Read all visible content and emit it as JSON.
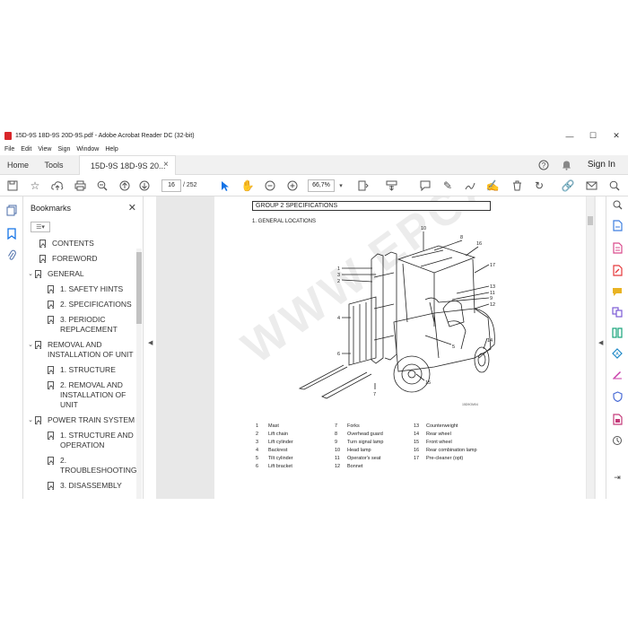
{
  "window": {
    "title": "15D-9S 18D-9S 20D-9S.pdf - Adobe Acrobat Reader DC (32-bit)",
    "minimize": "—",
    "maximize": "☐",
    "close": "✕"
  },
  "menu": [
    "File",
    "Edit",
    "View",
    "Sign",
    "Window",
    "Help"
  ],
  "tabs": {
    "home": "Home",
    "tools": "Tools",
    "document": "15D-9S 18D-9S 20...",
    "close": "×",
    "sign_in": "Sign In"
  },
  "toolbar": {
    "page_current": "16",
    "page_total": "/ 252",
    "zoom": "66,7%"
  },
  "bookmarks": {
    "header": "Bookmarks",
    "close": "✕",
    "options": "☰▾",
    "items": [
      {
        "label": "CONTENTS",
        "level": 0,
        "chevron": ""
      },
      {
        "label": "FOREWORD",
        "level": 0,
        "chevron": ""
      },
      {
        "label": "GENERAL",
        "level": 0,
        "chevron": "⌄"
      },
      {
        "label": "1. SAFETY HINTS",
        "level": 1,
        "chevron": ""
      },
      {
        "label": "2. SPECIFICATIONS",
        "level": 1,
        "chevron": ""
      },
      {
        "label": "3. PERIODIC REPLACEMENT",
        "level": 1,
        "chevron": ""
      },
      {
        "label": "REMOVAL AND INSTALLATION OF UNIT",
        "level": 0,
        "chevron": "⌄"
      },
      {
        "label": "1. STRUCTURE",
        "level": 1,
        "chevron": ""
      },
      {
        "label": "2. REMOVAL AND INSTALLATION OF UNIT",
        "level": 1,
        "chevron": ""
      },
      {
        "label": "POWER TRAIN SYSTEM",
        "level": 0,
        "chevron": "⌄"
      },
      {
        "label": "1. STRUCTURE AND OPERATION",
        "level": 1,
        "chevron": ""
      },
      {
        "label": "2. TROUBLESHOOTING",
        "level": 1,
        "chevron": ""
      },
      {
        "label": "3. DISASSEMBLY",
        "level": 1,
        "chevron": ""
      }
    ]
  },
  "document": {
    "group_heading": "GROUP 2  SPECIFICATIONS",
    "section_heading": "1. GENERAL LOCATIONS",
    "figure_code": "15D9OM04",
    "watermark": "WWW.EPCATALOG.COM",
    "callouts": [
      "10",
      "8",
      "16",
      "17",
      "1",
      "3",
      "2",
      "13",
      "11",
      "9",
      "12",
      "4",
      "6",
      "14",
      "5",
      "15",
      "7"
    ],
    "legend": [
      [
        {
          "n": "1",
          "t": "Mast"
        },
        {
          "n": "2",
          "t": "Lift chain"
        },
        {
          "n": "3",
          "t": "Lift cylinder"
        },
        {
          "n": "4",
          "t": "Backrest"
        },
        {
          "n": "5",
          "t": "Tilt cylinder"
        },
        {
          "n": "6",
          "t": "Lift bracket"
        }
      ],
      [
        {
          "n": "7",
          "t": "Forks"
        },
        {
          "n": "8",
          "t": "Overhead guard"
        },
        {
          "n": "9",
          "t": "Turn signal lamp"
        },
        {
          "n": "10",
          "t": "Head lamp"
        },
        {
          "n": "11",
          "t": "Operator's seat"
        },
        {
          "n": "12",
          "t": "Bonnet"
        }
      ],
      [
        {
          "n": "13",
          "t": "Counterweight"
        },
        {
          "n": "14",
          "t": "Rear wheel"
        },
        {
          "n": "15",
          "t": "Front wheel"
        },
        {
          "n": "16",
          "t": "Rear combination lamp"
        },
        {
          "n": "17",
          "t": "Pre-cleaner (opt)"
        }
      ]
    ]
  },
  "colors": {
    "accent": "#1473e6",
    "pdf_red": "#d9262a",
    "right_tools": [
      "#3d7ee0",
      "#2aa16a",
      "#d94a8c",
      "#e5383b",
      "#e9b323",
      "#7b5ad6",
      "#16a37a",
      "#1c88c7",
      "#c83ba9",
      "#4a6cd6",
      "#c43b7a"
    ]
  }
}
